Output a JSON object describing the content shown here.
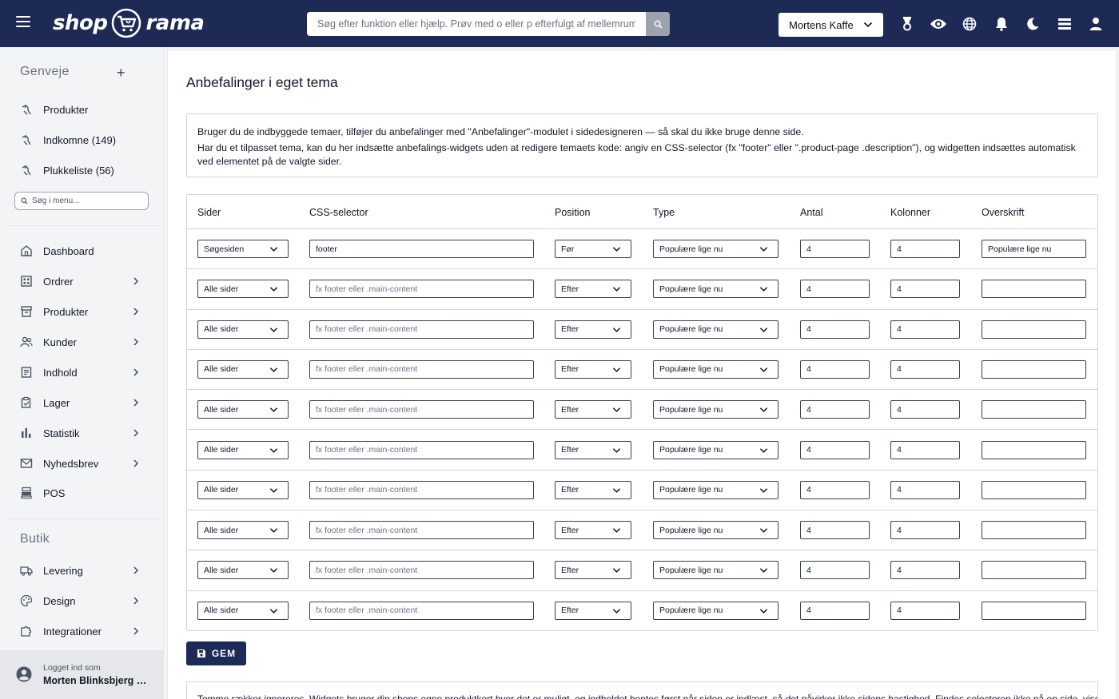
{
  "header": {
    "logo_left": "shop",
    "logo_right": "rama",
    "search_placeholder": "Søg efter funktion eller hjælp. Prøv med o eller p efterfulgt af mellemrum",
    "shop_name": "Mortens Kaffe",
    "icons": [
      "award-icon",
      "eye-icon",
      "globe-icon",
      "bell-icon",
      "moon-icon",
      "stack-icon",
      "user-icon"
    ]
  },
  "sidebar": {
    "shortcuts_title": "Genveje",
    "shortcuts": [
      {
        "label": "Produkter"
      },
      {
        "label": "Indkomne (149)"
      },
      {
        "label": "Plukkeliste (56)"
      }
    ],
    "menu_search_placeholder": "Søg i menu...",
    "nav": [
      {
        "label": "Dashboard",
        "icon": "home-icon",
        "arrow": false
      },
      {
        "label": "Ordrer",
        "icon": "grid-icon",
        "arrow": true
      },
      {
        "label": "Produkter",
        "icon": "box-icon",
        "arrow": true
      },
      {
        "label": "Kunder",
        "icon": "users-icon",
        "arrow": true
      },
      {
        "label": "Indhold",
        "icon": "document-icon",
        "arrow": true
      },
      {
        "label": "Lager",
        "icon": "clipboard-icon",
        "arrow": true
      },
      {
        "label": "Statistik",
        "icon": "bar-chart-icon",
        "arrow": true
      },
      {
        "label": "Nyhedsbrev",
        "icon": "mail-icon",
        "arrow": true
      },
      {
        "label": "POS",
        "icon": "register-icon",
        "arrow": false
      }
    ],
    "shop_title": "Butik",
    "shop_nav": [
      {
        "label": "Levering",
        "icon": "truck-icon",
        "arrow": true
      },
      {
        "label": "Design",
        "icon": "palette-icon",
        "arrow": true
      },
      {
        "label": "Integrationer",
        "icon": "puzzle-icon",
        "arrow": true
      }
    ],
    "user": {
      "logged_in_as": "Logget ind som",
      "name": "Morten Blinksbjerg N..."
    }
  },
  "main": {
    "title": "Anbefalinger i eget tema",
    "info_line1": "Bruger du de indbyggede temaer, tilføjer du anbefalinger med \"Anbefalinger\"-modulet i sidedesigneren — så skal du ikke bruge denne side.",
    "info_line2": "Har du et tilpasset tema, kan du her indsætte anbefalings-widgets uden at redigere temaets kode: angiv en CSS-selector (fx \"footer\" eller \".product-page .description\"), og widgetten indsættes automatisk ved elementet på de valgte sider.",
    "columns": [
      "Sider",
      "CSS-selector",
      "Position",
      "Type",
      "Antal",
      "Kolonner",
      "Overskrift"
    ],
    "selector_placeholder": "fx footer eller .main-content",
    "rows": [
      {
        "sider": "Søgesiden",
        "selector": "footer",
        "position": "Før",
        "type": "Populære lige nu",
        "antal": "4",
        "kolonner": "4",
        "overskrift": "Populære lige nu"
      },
      {
        "sider": "Alle sider",
        "selector": "",
        "position": "Efter",
        "type": "Populære lige nu",
        "antal": "4",
        "kolonner": "4",
        "overskrift": ""
      },
      {
        "sider": "Alle sider",
        "selector": "",
        "position": "Efter",
        "type": "Populære lige nu",
        "antal": "4",
        "kolonner": "4",
        "overskrift": ""
      },
      {
        "sider": "Alle sider",
        "selector": "",
        "position": "Efter",
        "type": "Populære lige nu",
        "antal": "4",
        "kolonner": "4",
        "overskrift": ""
      },
      {
        "sider": "Alle sider",
        "selector": "",
        "position": "Efter",
        "type": "Populære lige nu",
        "antal": "4",
        "kolonner": "4",
        "overskrift": ""
      },
      {
        "sider": "Alle sider",
        "selector": "",
        "position": "Efter",
        "type": "Populære lige nu",
        "antal": "4",
        "kolonner": "4",
        "overskrift": ""
      },
      {
        "sider": "Alle sider",
        "selector": "",
        "position": "Efter",
        "type": "Populære lige nu",
        "antal": "4",
        "kolonner": "4",
        "overskrift": ""
      },
      {
        "sider": "Alle sider",
        "selector": "",
        "position": "Efter",
        "type": "Populære lige nu",
        "antal": "4",
        "kolonner": "4",
        "overskrift": ""
      },
      {
        "sider": "Alle sider",
        "selector": "",
        "position": "Efter",
        "type": "Populære lige nu",
        "antal": "4",
        "kolonner": "4",
        "overskrift": ""
      },
      {
        "sider": "Alle sider",
        "selector": "",
        "position": "Efter",
        "type": "Populære lige nu",
        "antal": "4",
        "kolonner": "4",
        "overskrift": ""
      }
    ],
    "save_label": "GEM",
    "note": "Tomme rækker ignoreres. Widgets bruger din shops egne produktkort hvor det er muligt, og indholdet hentes først når siden er indlæst, så det påvirker ikke sidens hastighed. Findes selectoren ikke på en side, vises widgetten"
  },
  "colors": {
    "header_bg": "#1c2a55",
    "save_button_bg": "#1c2a55",
    "sidebar_bg": "#f3f4f6"
  }
}
